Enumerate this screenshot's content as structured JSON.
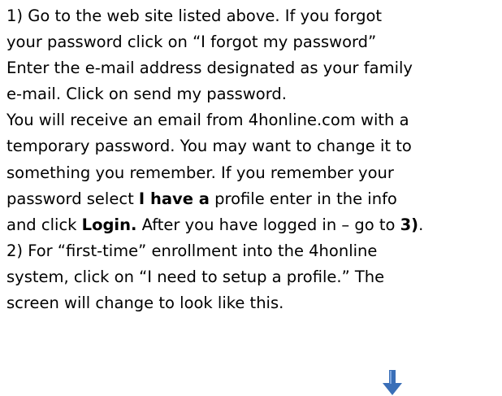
{
  "paragraph1": {
    "line1": "1) Go to the web site listed above.  If you forgot",
    "line2": "your password click on “I forgot my password”",
    "line3": "Enter the e-mail address designated as your family",
    "line4": "e-mail. Click on send my password.",
    "line5": "You will receive an email from 4honline.com with a",
    "line6": "temporary password. You may want to change it to",
    "line7": "something you remember. If you remember your",
    "line8_a": "password select ",
    "line8_b": "I have a",
    "line8_c": " profile enter in the info",
    "line9_a": "and click ",
    "line9_b": "Login.",
    "line9_c": " After you have logged in – go to ",
    "line9_d": "3)",
    "line9_e": "."
  },
  "paragraph2": {
    "line1": "2) For “first-time” enrollment into the 4honline",
    "line2": "system, click on “I need to setup a profile.” The",
    "line3": "screen will change to look like this."
  },
  "arrow": {
    "icon": "down-arrow-icon",
    "color": "#3a6fb8"
  }
}
